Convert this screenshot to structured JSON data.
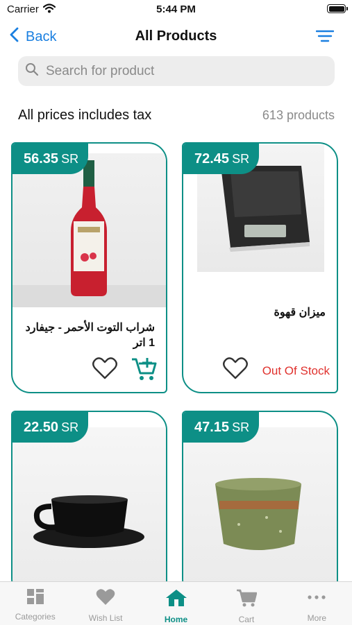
{
  "status": {
    "carrier": "Carrier",
    "time": "5:44 PM"
  },
  "nav": {
    "back_label": "Back",
    "title": "All Products"
  },
  "search": {
    "placeholder": "Search for product"
  },
  "info": {
    "tax_note": "All prices includes tax",
    "count": "613 products"
  },
  "products": [
    {
      "price": "56.35",
      "currency": "SR",
      "name": "شراب التوت الأحمر - جيفارد 1 اتر",
      "in_stock": true
    },
    {
      "price": "72.45",
      "currency": "SR",
      "name": "ميزان قهوة",
      "in_stock": false,
      "stock_label": "Out Of Stock"
    },
    {
      "price": "22.50",
      "currency": "SR"
    },
    {
      "price": "47.15",
      "currency": "SR"
    }
  ],
  "tabs": [
    {
      "label": "Categories",
      "icon": "grid-icon"
    },
    {
      "label": "Wish List",
      "icon": "heart-icon"
    },
    {
      "label": "Home",
      "icon": "home-icon",
      "active": true
    },
    {
      "label": "Cart",
      "icon": "cart-icon"
    },
    {
      "label": "More",
      "icon": "more-dots-icon"
    }
  ],
  "colors": {
    "accent": "#0d8f86",
    "link": "#1a7fe0",
    "out_of_stock": "#e0312d"
  }
}
